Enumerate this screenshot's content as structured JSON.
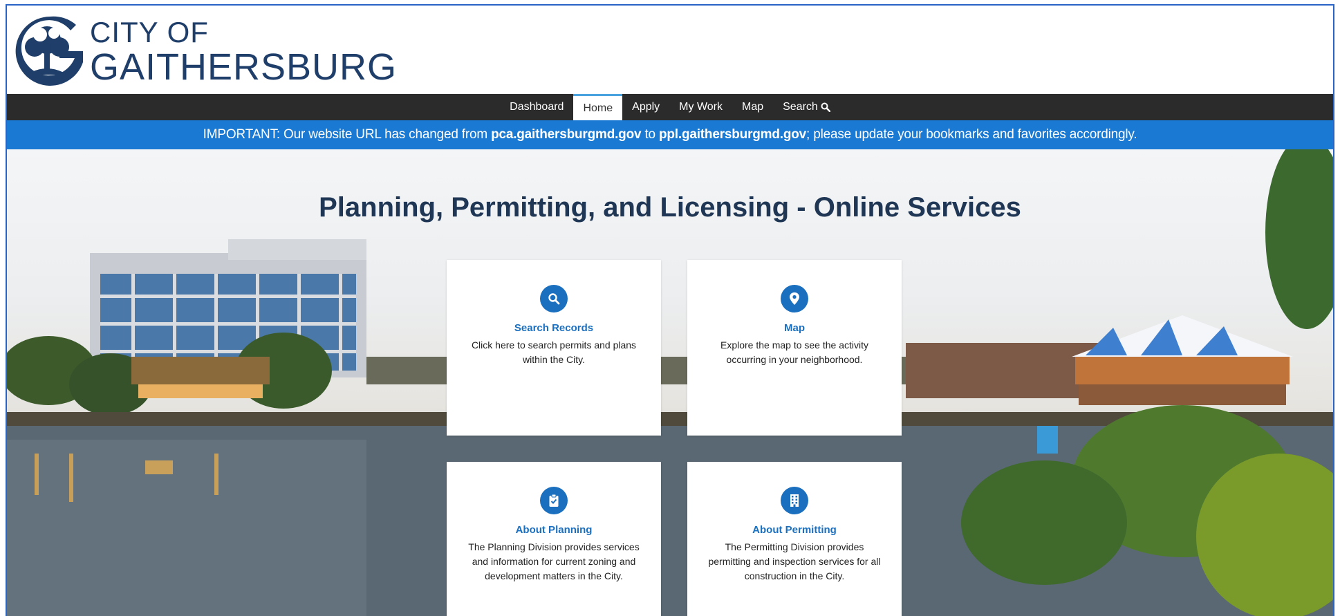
{
  "logo": {
    "line1": "CITY OF",
    "line2": "GAITHERSBURG"
  },
  "nav": {
    "items": [
      {
        "label": "Dashboard"
      },
      {
        "label": "Home"
      },
      {
        "label": "Apply"
      },
      {
        "label": "My Work"
      },
      {
        "label": "Map"
      },
      {
        "label": "Search"
      }
    ],
    "active": "Home"
  },
  "banner": {
    "prefix": "IMPORTANT: Our website URL has changed from ",
    "old_url": "pca.gaithersburgmd.gov",
    "middle": " to ",
    "new_url": "ppl.gaithersburgmd.gov",
    "suffix": "; please update your bookmarks and favorites accordingly."
  },
  "page_title": "Planning, Permitting, and Licensing - Online Services",
  "cards": [
    {
      "title": "Search Records",
      "desc": "Click here to search permits and plans within the City.",
      "icon": "search-icon"
    },
    {
      "title": "Map",
      "desc": "Explore the map to see the activity occurring in your neighborhood.",
      "icon": "map-pin-icon"
    },
    {
      "title": "About Planning",
      "desc": "The Planning Division provides services and information for current zoning and development matters in the City.",
      "icon": "clipboard-check-icon"
    },
    {
      "title": "About Permitting",
      "desc": "The Permitting Division provides permitting and inspection services for all construction in the City.",
      "icon": "building-icon"
    }
  ],
  "colors": {
    "brand_navy": "#1f3e69",
    "banner_blue": "#1a79d3",
    "nav_bg": "#2b2b2b",
    "accent_blue": "#1a6fbf"
  }
}
